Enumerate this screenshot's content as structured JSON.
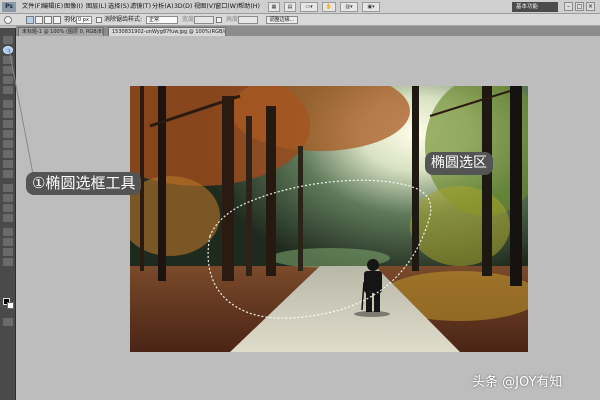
{
  "app": {
    "logo": "Ps"
  },
  "menubar": {
    "items": [
      "文件(F)",
      "编辑(E)",
      "图像(I)",
      "图层(L)",
      "选择(S)",
      "滤镜(T)",
      "分析(A)",
      "3D(D)",
      "视图(V)",
      "窗口(W)",
      "帮助(H)"
    ],
    "workspace": "基本功能"
  },
  "options": {
    "feather_label": "羽化:",
    "feather_value": "0 px",
    "antialias_label": "消除锯齿",
    "style_label": "样式:",
    "style_value": "正常",
    "width_label": "宽度:",
    "height_label": "高度:",
    "refine_edge": "调整边缘..."
  },
  "tabs": [
    {
      "label": "未标题-1 @ 100% (图层 0, RGB/8) *"
    },
    {
      "label": "1530831902-unWyg87fuw.jpg @ 100%(RGB/8#)"
    }
  ],
  "annotations": {
    "tool_label": "①椭圆选框工具",
    "selection_label": "椭圆选区"
  },
  "watermark": "头条 @JOY有知",
  "colors": {
    "annotation_bg": "#545454",
    "tool_active": "#a8c8ee",
    "canvas_bg": "#bdbdbd"
  },
  "icons": {
    "active_tool": "elliptical-marquee-icon",
    "photo_subject": "person-walking-with-cane-image"
  }
}
